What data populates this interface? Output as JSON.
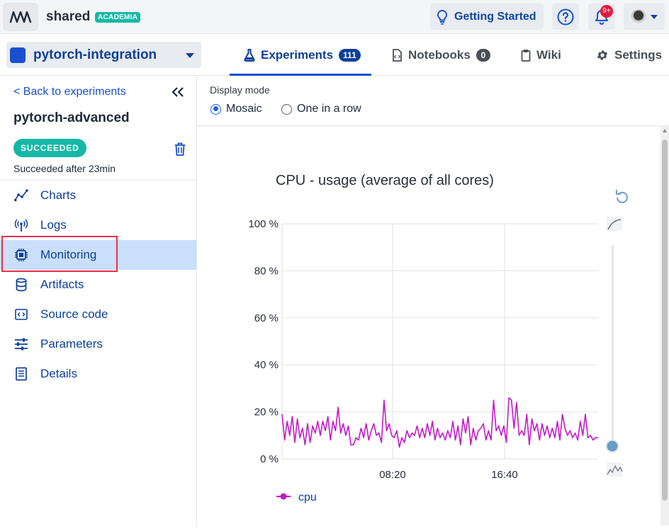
{
  "topbar": {
    "org_name": "shared",
    "org_badge": "ACADEMIA",
    "getting_started": "Getting Started",
    "notif_count": "9+"
  },
  "project": {
    "name": "pytorch-integration"
  },
  "tabs": [
    {
      "label": "Experiments",
      "count": "111",
      "active": true
    },
    {
      "label": "Notebooks",
      "count": "0",
      "active": false
    },
    {
      "label": "Wiki",
      "active": false
    },
    {
      "label": "Settings",
      "active": false
    }
  ],
  "sidebar": {
    "back_label": "< Back to experiments",
    "experiment_title": "pytorch-advanced",
    "status_badge": "SUCCEEDED",
    "status_text": "Succeeded after 23min",
    "items": [
      {
        "label": "Charts",
        "icon": "chart-line-icon"
      },
      {
        "label": "Logs",
        "icon": "broadcast-icon"
      },
      {
        "label": "Monitoring",
        "icon": "cpu-chip-icon",
        "active": true
      },
      {
        "label": "Artifacts",
        "icon": "database-icon"
      },
      {
        "label": "Source code",
        "icon": "code-file-icon"
      },
      {
        "label": "Parameters",
        "icon": "sliders-icon"
      },
      {
        "label": "Details",
        "icon": "document-icon"
      }
    ]
  },
  "display_mode": {
    "label": "Display mode",
    "options": [
      "Mosaic",
      "One in a row"
    ],
    "selected": "Mosaic"
  },
  "colors": {
    "accent": "#1a4fd0",
    "series_cpu": "#c419c9",
    "status_success": "#15b8a6"
  },
  "chart_data": {
    "type": "line",
    "title": "CPU - usage (average of all cores)",
    "xlabel": "",
    "ylabel": "",
    "x_ticks": [
      "08:20",
      "16:40"
    ],
    "y_ticks": [
      "100 %",
      "80 %",
      "60 %",
      "40 %",
      "20 %",
      "0 %"
    ],
    "ylim": [
      0,
      100
    ],
    "legend_position": "bottom-left",
    "grid": true,
    "series": [
      {
        "name": "cpu",
        "values": [
          19,
          8,
          16,
          10,
          18,
          7,
          17,
          9,
          13,
          6,
          15,
          7,
          14,
          11,
          16,
          10,
          16,
          12,
          18,
          8,
          16,
          12,
          22,
          11,
          15,
          10,
          14,
          6,
          6,
          9,
          8,
          13,
          9,
          15,
          8,
          12,
          15,
          10,
          11,
          7,
          25,
          12,
          15,
          10,
          9,
          12,
          5,
          9,
          7,
          12,
          9,
          11,
          10,
          14,
          9,
          13,
          9,
          15,
          10,
          16,
          8,
          13,
          9,
          11,
          8,
          12,
          9,
          16,
          8,
          14,
          6,
          17,
          11,
          18,
          6,
          13,
          8,
          12,
          13,
          15,
          8,
          12,
          8,
          25,
          12,
          14,
          10,
          14,
          7,
          26,
          25,
          13,
          24,
          10,
          12,
          10,
          19,
          6,
          17,
          12,
          15,
          8,
          15,
          10,
          14,
          9,
          13,
          9,
          16,
          8,
          19,
          13,
          10,
          12,
          9,
          11,
          8,
          16,
          10,
          19,
          9,
          10,
          8,
          9,
          9
        ]
      }
    ]
  }
}
